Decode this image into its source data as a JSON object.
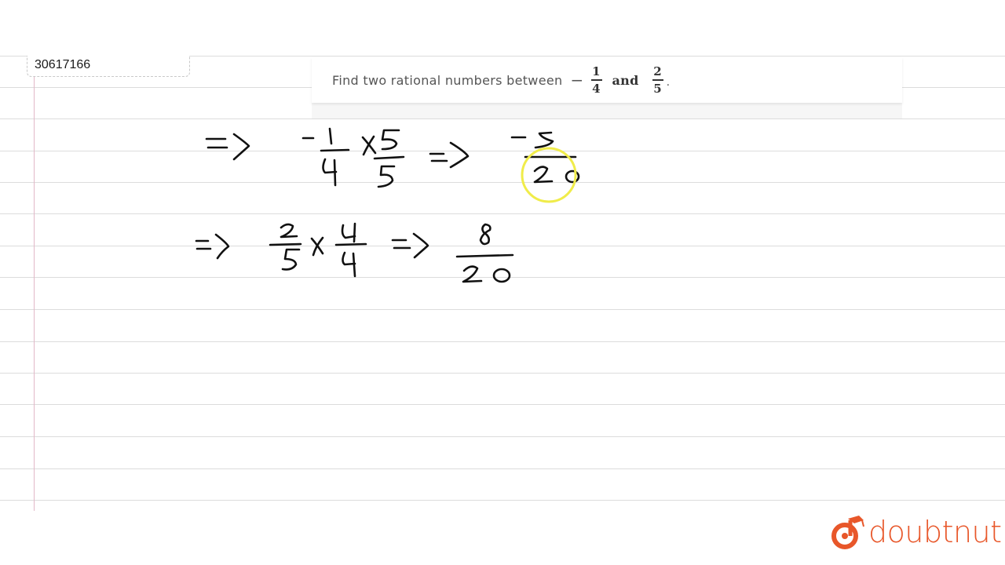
{
  "question_id": "30617166",
  "question": {
    "text": "Find two rational numbers between",
    "first_sign": "−",
    "first_fraction": {
      "numerator": "1",
      "denominator": "4"
    },
    "conjunction": "and",
    "second_fraction": {
      "numerator": "2",
      "denominator": "5"
    },
    "end": "."
  },
  "handwritten_steps": [
    {
      "lhs": "-1/4 × 5/5",
      "rhs": "-5/20"
    },
    {
      "lhs": "2/5 × 4/4",
      "rhs": "8/20"
    }
  ],
  "highlight": {
    "target": "20",
    "color": "#f0ec4a"
  },
  "brand": {
    "name": "doubtnut",
    "color": "#e8572a"
  }
}
